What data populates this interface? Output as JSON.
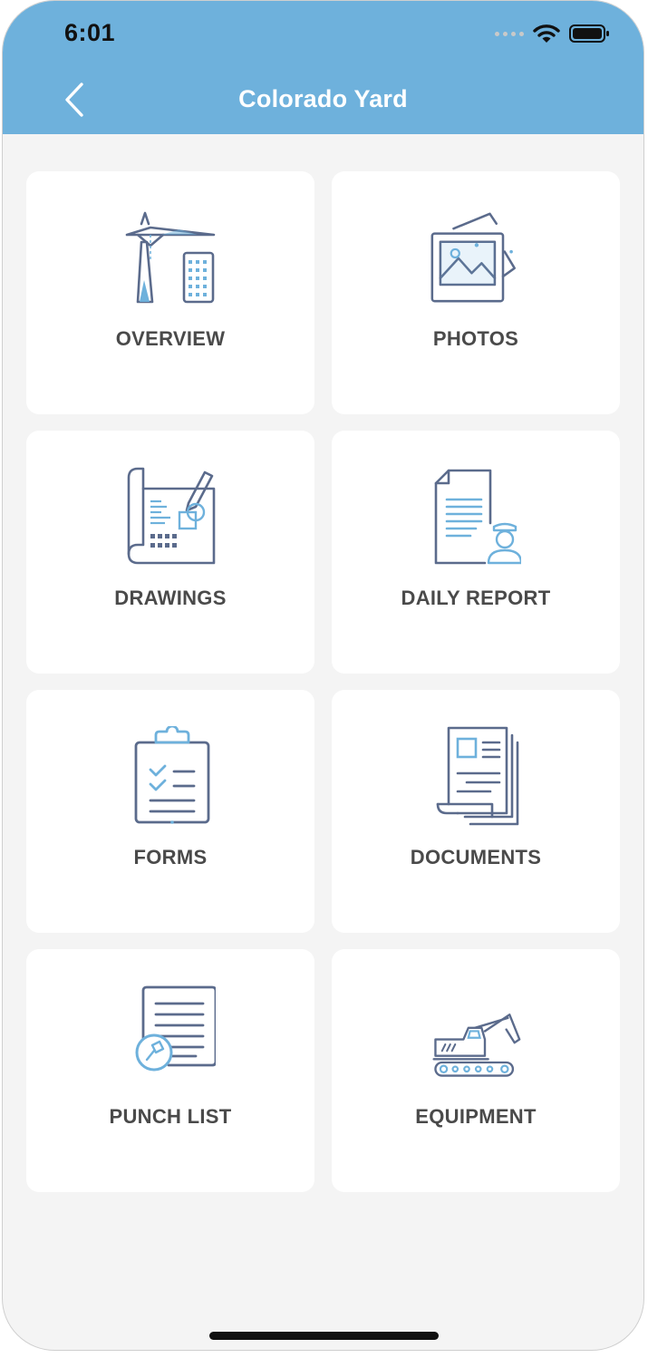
{
  "status_bar": {
    "time": "6:01"
  },
  "nav": {
    "title": "Colorado Yard"
  },
  "tiles": [
    {
      "label": "OVERVIEW",
      "icon": "tower-crane-icon"
    },
    {
      "label": "PHOTOS",
      "icon": "photos-icon"
    },
    {
      "label": "DRAWINGS",
      "icon": "blueprint-icon"
    },
    {
      "label": "DAILY REPORT",
      "icon": "daily-report-icon"
    },
    {
      "label": "FORMS",
      "icon": "clipboard-checklist-icon"
    },
    {
      "label": "DOCUMENTS",
      "icon": "documents-icon"
    },
    {
      "label": "PUNCH LIST",
      "icon": "punch-list-icon"
    },
    {
      "label": "EQUIPMENT",
      "icon": "excavator-icon"
    }
  ],
  "colors": {
    "header": "#6eb1dc",
    "icon_dark": "#5b6b8c",
    "icon_accent": "#6eb1dc",
    "background": "#f4f4f4"
  }
}
